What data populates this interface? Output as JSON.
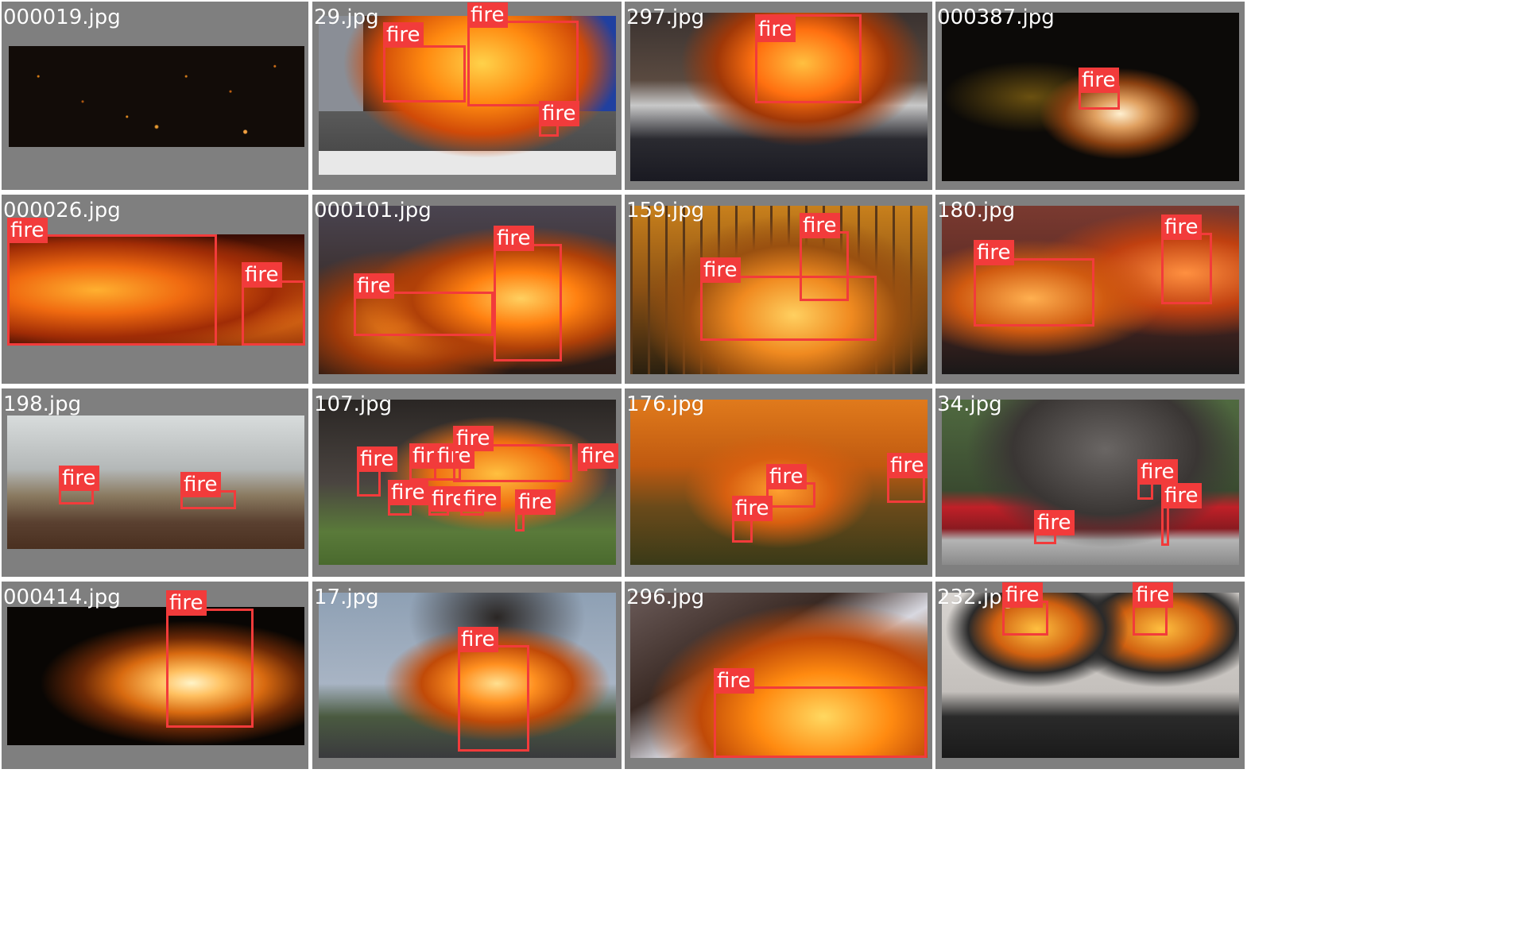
{
  "grid": {
    "tiles": [
      {
        "filename": "000019.jpg",
        "scene": "dark-embers",
        "detections": []
      },
      {
        "filename": "29.jpg",
        "scene": "truck-fire",
        "detections": [
          {
            "label": "fire"
          },
          {
            "label": "fire"
          },
          {
            "label": "fire"
          }
        ]
      },
      {
        "filename": "297.jpg",
        "scene": "tanker-firefighters",
        "detections": [
          {
            "label": "fire"
          }
        ]
      },
      {
        "filename": "000387.jpg",
        "scene": "spinning-sparks",
        "detections": [
          {
            "label": "fire"
          }
        ]
      },
      {
        "filename": "000026.jpg",
        "scene": "flames-closeup",
        "detections": [
          {
            "label": "fire"
          },
          {
            "label": "fire"
          }
        ]
      },
      {
        "filename": "000101.jpg",
        "scene": "house-fire",
        "detections": [
          {
            "label": "fire"
          },
          {
            "label": "fire"
          }
        ]
      },
      {
        "filename": "159.jpg",
        "scene": "forest-fire",
        "detections": [
          {
            "label": "fire"
          },
          {
            "label": "fire"
          }
        ]
      },
      {
        "filename": "180.jpg",
        "scene": "palm-roof-fire",
        "detections": [
          {
            "label": "fire"
          },
          {
            "label": "fire"
          }
        ]
      },
      {
        "filename": "198.jpg",
        "scene": "brush-smoke",
        "detections": [
          {
            "label": "fire"
          },
          {
            "label": "fire"
          }
        ]
      },
      {
        "filename": "107.jpg",
        "scene": "house-firefighters",
        "detections": [
          {
            "label": "fire"
          },
          {
            "label": "fire"
          },
          {
            "label": "fire"
          },
          {
            "label": "fire"
          },
          {
            "label": "fire"
          },
          {
            "label": "fire"
          },
          {
            "label": "fire"
          },
          {
            "label": "fire"
          },
          {
            "label": "fire"
          },
          {
            "label": "fire"
          },
          {
            "label": "fire"
          }
        ]
      },
      {
        "filename": "176.jpg",
        "scene": "orange-forest-fire",
        "detections": [
          {
            "label": "fire"
          },
          {
            "label": "fire"
          },
          {
            "label": "fire"
          }
        ]
      },
      {
        "filename": "34.jpg",
        "scene": "bus-fire",
        "detections": [
          {
            "label": "fire"
          },
          {
            "label": "fire"
          },
          {
            "label": "fire"
          }
        ]
      },
      {
        "filename": "000414.jpg",
        "scene": "campfire-night",
        "detections": [
          {
            "label": "fire"
          }
        ]
      },
      {
        "filename": "17.jpg",
        "scene": "road-vehicle-fire",
        "detections": [
          {
            "label": "fire"
          }
        ]
      },
      {
        "filename": "296.jpg",
        "scene": "tanker-explosion",
        "detections": [
          {
            "label": "fire"
          }
        ]
      },
      {
        "filename": "232.jpg",
        "scene": "gas-stove",
        "detections": [
          {
            "label": "fire"
          },
          {
            "label": "fire"
          }
        ]
      }
    ]
  },
  "colors": {
    "background": "#7f7f7f",
    "box": "#f23b3b",
    "label_text": "#ffffff"
  }
}
